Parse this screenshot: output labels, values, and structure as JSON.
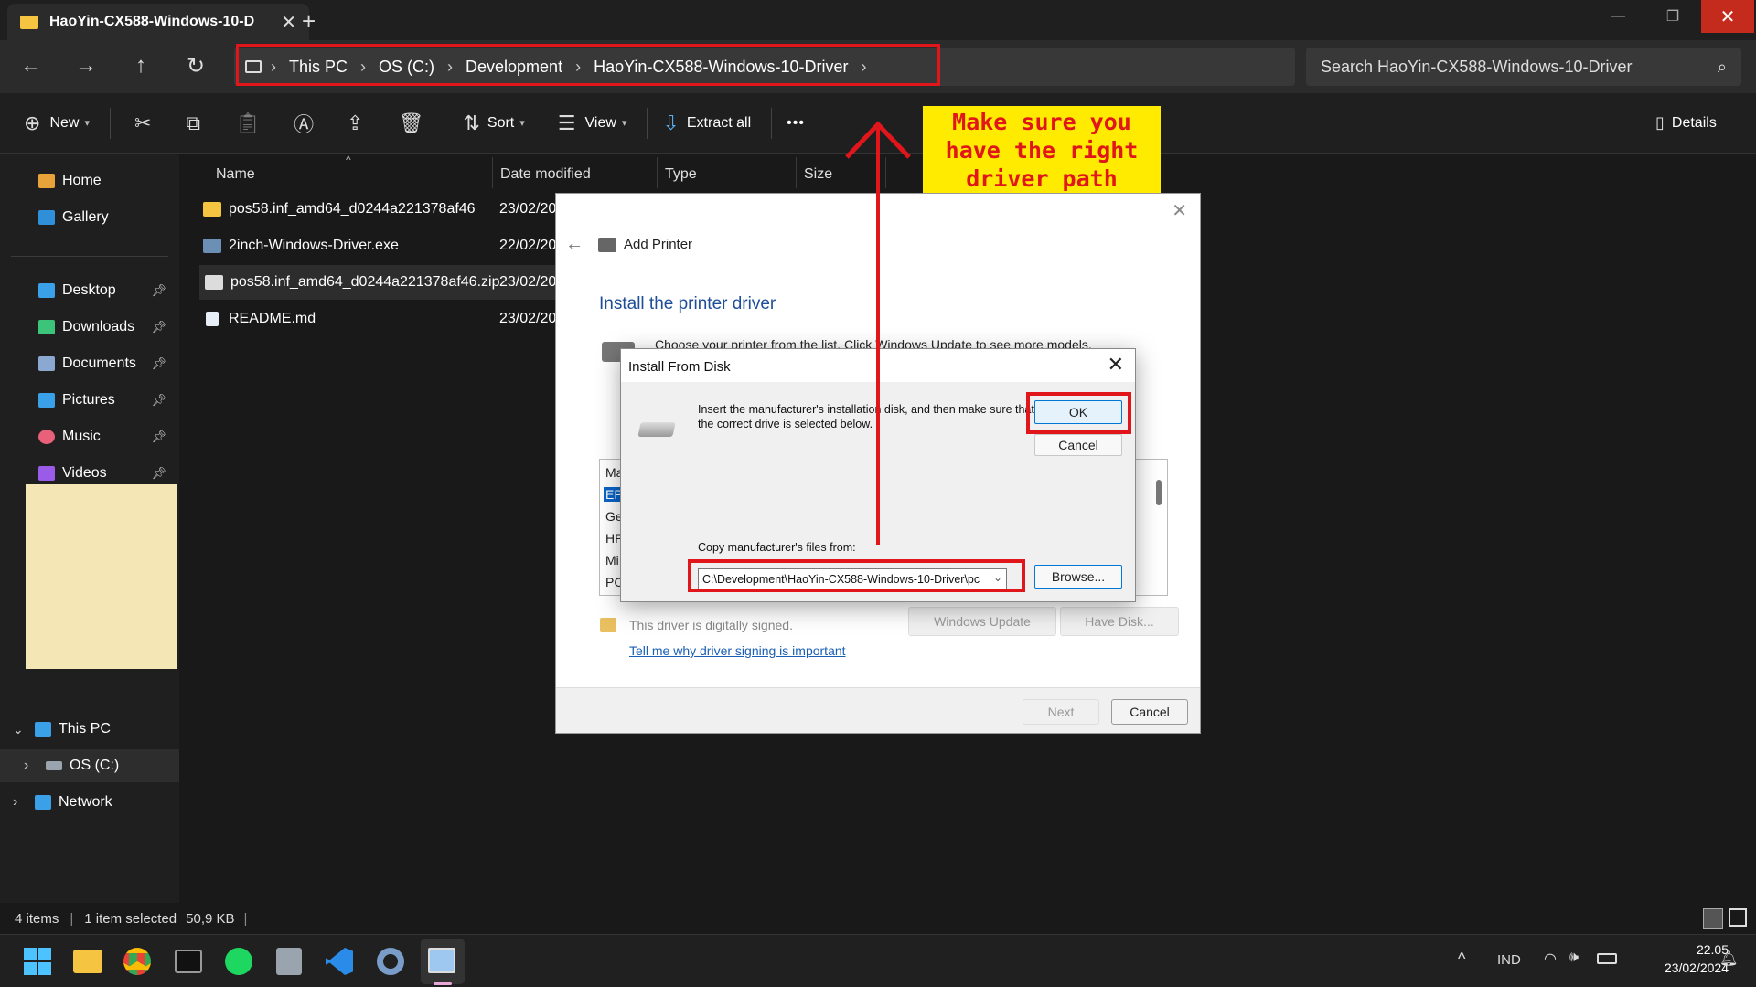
{
  "window": {
    "tab_title": "HaoYin-CX588-Windows-10-D",
    "new_tab": "+",
    "minimize": "—",
    "maximize": "❐",
    "close": "✕"
  },
  "address": {
    "segments": [
      "This PC",
      "OS (C:)",
      "Development",
      "HaoYin-CX588-Windows-10-Driver"
    ],
    "search_placeholder": "Search HaoYin-CX588-Windows-10-Driver"
  },
  "toolbar": {
    "new_label": "New",
    "sort_label": "Sort",
    "view_label": "View",
    "extract_label": "Extract all",
    "more_label": "•••",
    "details_label": "Details"
  },
  "sidebar": {
    "items": [
      {
        "label": "Home",
        "icon": "home-icon",
        "color": "#e8a23a"
      },
      {
        "label": "Gallery",
        "icon": "gallery-icon",
        "color": "#2f8fd8"
      },
      {
        "label": "Desktop",
        "icon": "desktop-icon",
        "color": "#3aa0e8",
        "pinned": true
      },
      {
        "label": "Downloads",
        "icon": "download-icon",
        "color": "#3cc47a",
        "pinned": true
      },
      {
        "label": "Documents",
        "icon": "documents-icon",
        "color": "#8aa8d0",
        "pinned": true
      },
      {
        "label": "Pictures",
        "icon": "pictures-icon",
        "color": "#3aa0e8",
        "pinned": true
      },
      {
        "label": "Music",
        "icon": "music-icon",
        "color": "#e8607a",
        "pinned": true
      },
      {
        "label": "Videos",
        "icon": "videos-icon",
        "color": "#9a5ce8",
        "pinned": true
      }
    ],
    "tree": [
      {
        "label": "This PC",
        "icon": "pc-icon",
        "chevron": "⌄"
      },
      {
        "label": "OS (C:)",
        "icon": "drive-icon",
        "chevron": "›"
      },
      {
        "label": "Network",
        "icon": "network-icon",
        "chevron": "›"
      }
    ]
  },
  "files": {
    "columns": [
      "Name",
      "Date modified",
      "Type",
      "Size"
    ],
    "rows": [
      {
        "name": "pos58.inf_amd64_d0244a221378af46",
        "date": "23/02/20",
        "icon": "folder-icon"
      },
      {
        "name": "2inch-Windows-Driver.exe",
        "date": "22/02/20",
        "icon": "exe-icon"
      },
      {
        "name": "pos58.inf_amd64_d0244a221378af46.zip",
        "date": "23/02/20",
        "icon": "zip-icon",
        "selected": true
      },
      {
        "name": "README.md",
        "date": "23/02/20",
        "icon": "md-icon"
      }
    ]
  },
  "annotation": {
    "note": "Make sure you have the right driver path",
    "color": "#e0161b"
  },
  "add_printer": {
    "title": "Add Printer",
    "heading": "Install the printer driver",
    "description": "Choose your printer from the list. Click Windows Update to see more models.",
    "list_items": [
      "Ma",
      "EP",
      "Ge",
      "HP",
      "Mi",
      "PC"
    ],
    "signed_text": "This driver is digitally signed.",
    "link_text": "Tell me why driver signing is important",
    "windows_update": "Windows Update",
    "have_disk": "Have Disk...",
    "next": "Next",
    "cancel": "Cancel"
  },
  "install_from_disk": {
    "title": "Install From Disk",
    "message": "Insert the manufacturer's installation disk, and then make sure that the correct drive is selected below.",
    "ok": "OK",
    "cancel": "Cancel",
    "copy_label": "Copy manufacturer's files from:",
    "path_value": "C:\\Development\\HaoYin-CX588-Windows-10-Driver\\pc",
    "browse": "Browse..."
  },
  "status": {
    "items": "4 items",
    "selected": "1 item selected",
    "size": "50,9 KB"
  },
  "tray": {
    "language": "IND",
    "time": "22.05",
    "date": "23/02/2024"
  }
}
